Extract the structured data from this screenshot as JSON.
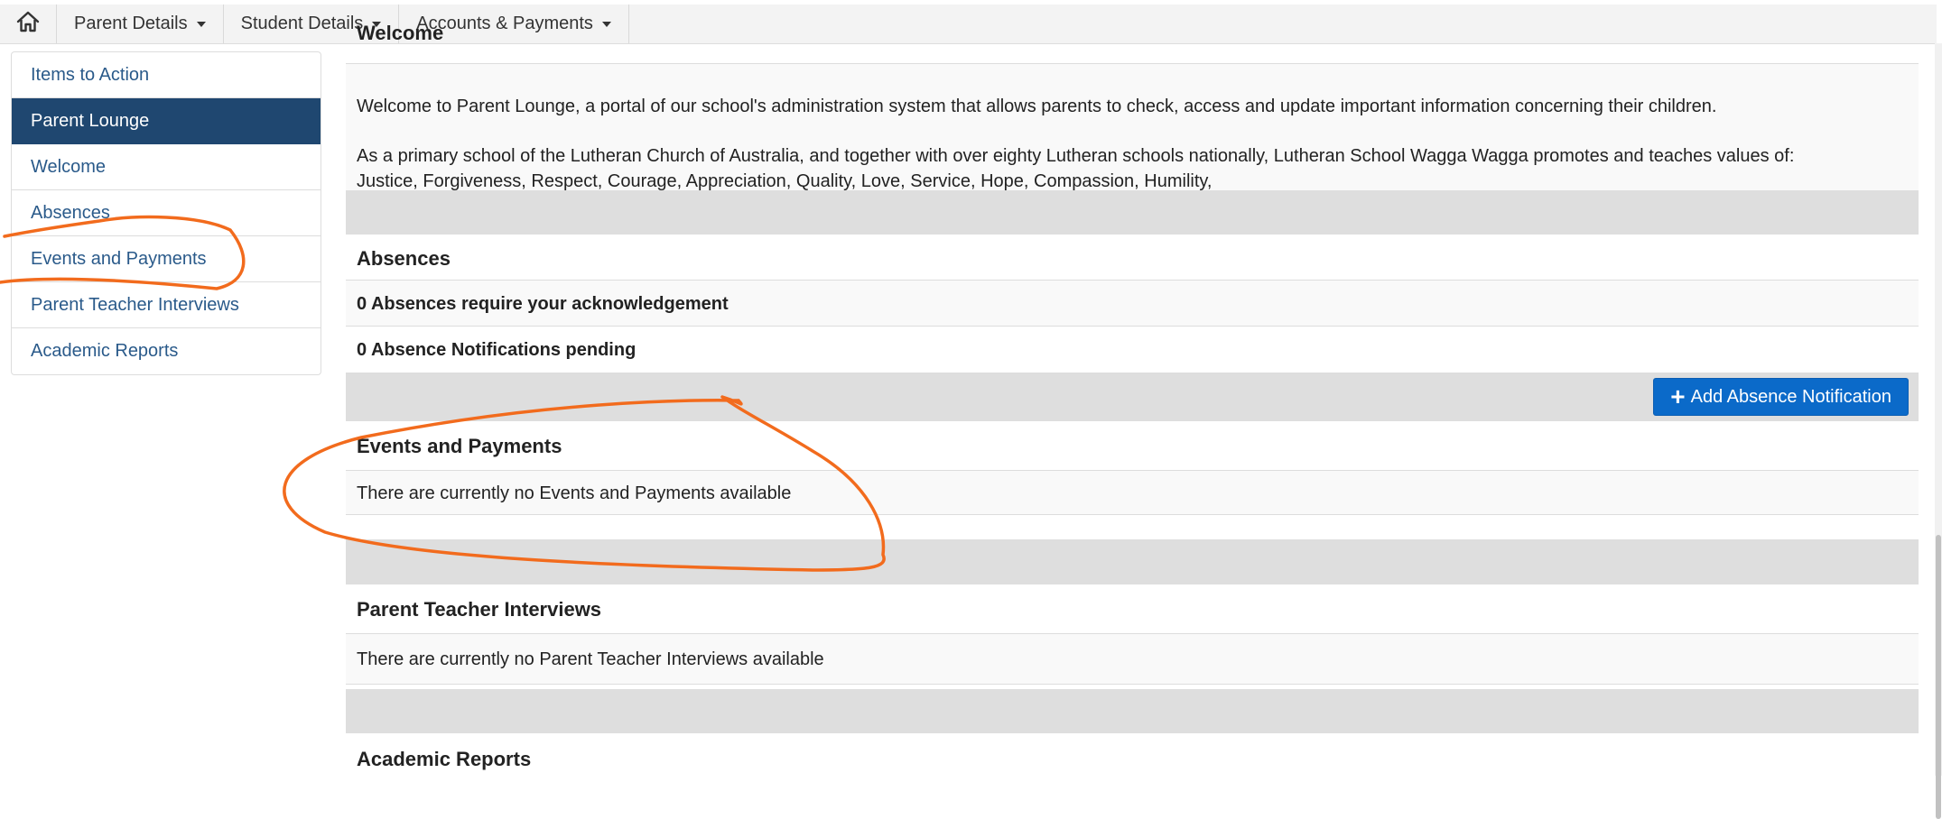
{
  "topnav": {
    "home_icon": "home-icon",
    "items": [
      {
        "label": "Parent Details"
      },
      {
        "label": "Student Details"
      },
      {
        "label": "Accounts & Payments"
      }
    ]
  },
  "sidebar": {
    "items": [
      {
        "label": "Items to Action"
      },
      {
        "label": "Parent Lounge",
        "active": true
      },
      {
        "label": "Welcome"
      },
      {
        "label": "Absences"
      },
      {
        "label": "Events and Payments"
      },
      {
        "label": "Parent Teacher Interviews"
      },
      {
        "label": "Academic Reports"
      }
    ]
  },
  "main": {
    "welcome": {
      "title": "Welcome",
      "paragraph1": "Welcome to Parent Lounge, a portal of our school's administration system that allows parents to check, access and update important information concerning their children.",
      "paragraph2_line1": "As a primary school of the Lutheran Church of Australia, and together with over eighty Lutheran schools nationally, Lutheran School Wagga Wagga promotes and teaches values of:",
      "paragraph2_line2": "Justice, Forgiveness, Respect, Courage, Appreciation, Quality, Love, Service, Hope, Compassion, Humility,"
    },
    "absences": {
      "title": "Absences",
      "acknowledge_text": "0 Absences require your acknowledgement",
      "pending_text": "0 Absence Notifications pending",
      "add_button_label": "Add Absence Notification",
      "add_button_icon": "plus-icon"
    },
    "events": {
      "title": "Events and Payments",
      "empty_text": "There are currently no Events and Payments available"
    },
    "interviews": {
      "title": "Parent Teacher Interviews",
      "empty_text": "There are currently no Parent Teacher Interviews available"
    },
    "reports": {
      "title": "Academic Reports"
    }
  },
  "colors": {
    "sidebar_active": "#1f4770",
    "link": "#2a5a8a",
    "button": "#0b6ac9",
    "annotation": "#f26b1d"
  }
}
